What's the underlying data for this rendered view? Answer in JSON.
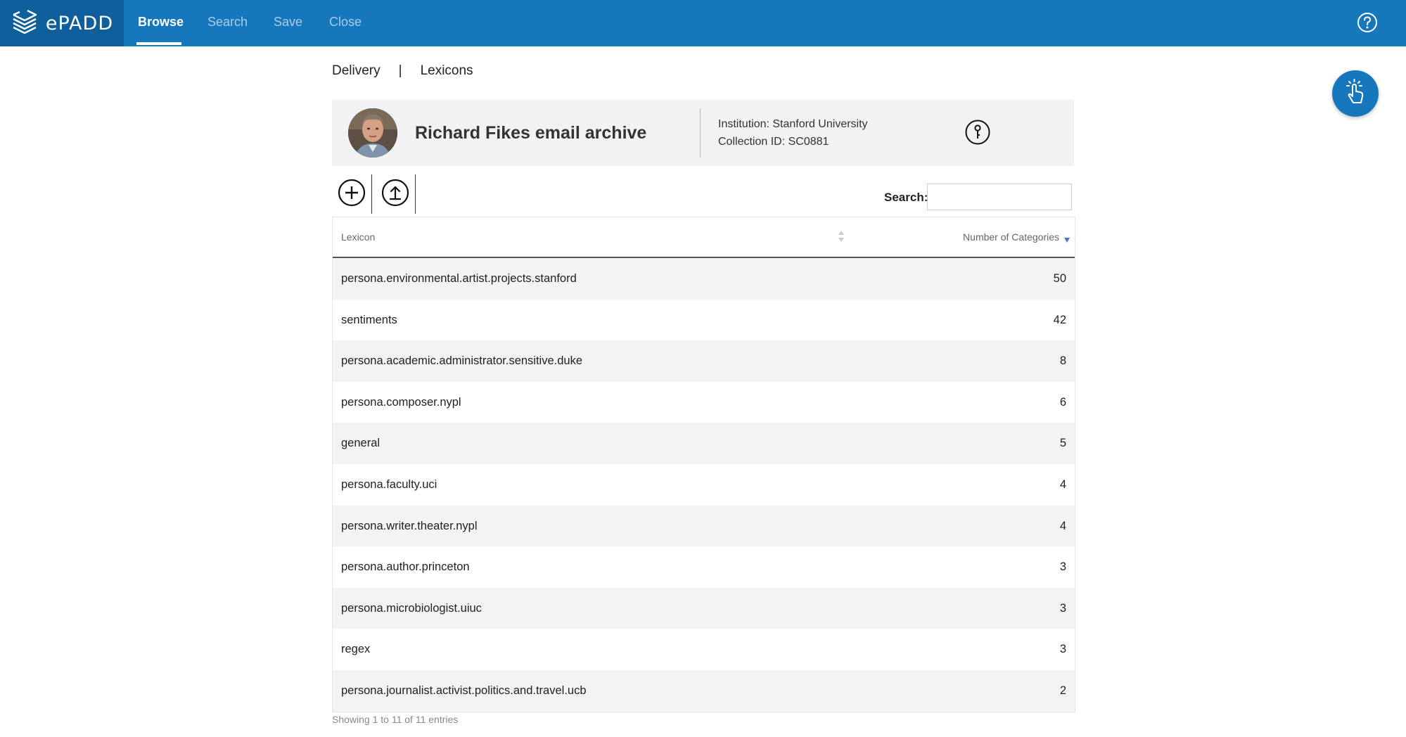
{
  "app": {
    "logo_text": "ePADD"
  },
  "nav": {
    "items": [
      {
        "label": "Browse",
        "active": true
      },
      {
        "label": "Search",
        "active": false
      },
      {
        "label": "Save",
        "active": false
      },
      {
        "label": "Close",
        "active": false
      }
    ]
  },
  "breadcrumb": {
    "first": "Delivery",
    "separator": "|",
    "second": "Lexicons"
  },
  "archive": {
    "title": "Richard Fikes email archive",
    "institution": "Institution: Stanford University",
    "collection_id": "Collection ID: SC0881"
  },
  "search": {
    "label": "Search:",
    "value": "",
    "placeholder": ""
  },
  "table": {
    "columns": [
      "Lexicon",
      "Number of Categories"
    ],
    "rows": [
      {
        "name": "persona.environmental.artist.projects.stanford",
        "count": "50"
      },
      {
        "name": "sentiments",
        "count": "42"
      },
      {
        "name": "persona.academic.administrator.sensitive.duke",
        "count": "8"
      },
      {
        "name": "persona.composer.nypl",
        "count": "6"
      },
      {
        "name": "general",
        "count": "5"
      },
      {
        "name": "persona.faculty.uci",
        "count": "4"
      },
      {
        "name": "persona.writer.theater.nypl",
        "count": "4"
      },
      {
        "name": "persona.author.princeton",
        "count": "3"
      },
      {
        "name": "persona.microbiologist.uiuc",
        "count": "3"
      },
      {
        "name": "regex",
        "count": "3"
      },
      {
        "name": "persona.journalist.activist.politics.and.travel.ucb",
        "count": "2"
      }
    ],
    "info": "Showing 1 to 11 of 11 entries"
  },
  "colors": {
    "brand": "#1677bd",
    "brand_dark": "#0f5f9c",
    "sort_active": "#5a6fd6"
  },
  "icons": [
    "layers-logo-icon",
    "help-circle-icon",
    "tap-gesture-icon",
    "info-key-icon",
    "add-circle-icon",
    "upload-circle-icon",
    "sort-both-icon",
    "sort-desc-icon"
  ]
}
